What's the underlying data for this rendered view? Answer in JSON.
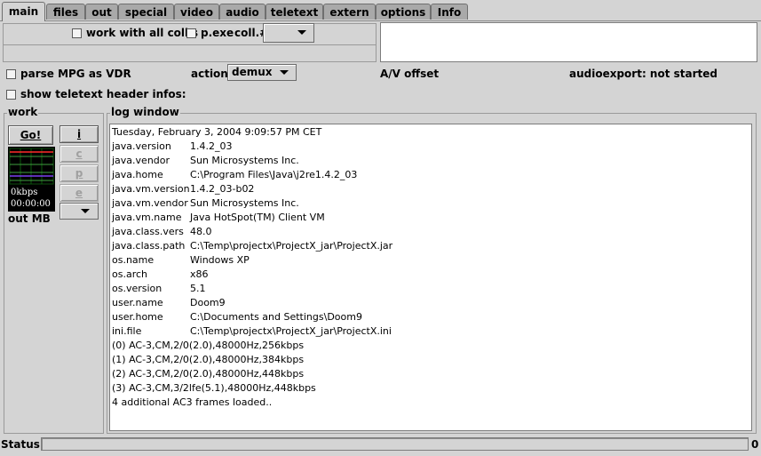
{
  "tabs": [
    {
      "label": "main",
      "active": true
    },
    {
      "label": "files"
    },
    {
      "label": "out"
    },
    {
      "label": "special"
    },
    {
      "label": "video"
    },
    {
      "label": "audio"
    },
    {
      "label": "teletext"
    },
    {
      "label": "extern"
    },
    {
      "label": "options"
    },
    {
      "label": "Info"
    }
  ],
  "options": {
    "work_all_colls": "work with all coll's",
    "pexe": "p.exe",
    "coll_label": "coll.#",
    "coll_value": "",
    "parse_mpg": "parse MPG as VDR",
    "action_label": "action:",
    "action_value": "demux",
    "av_offset": "A/V offset",
    "audioexport": "audioexport: not started",
    "show_teletext": "show teletext header infos:"
  },
  "work": {
    "title": "work",
    "go_button": "Go!",
    "i_button": "i",
    "c_button": "c",
    "p_button": "p",
    "e_button": "e",
    "meter_rate": "0kbps",
    "meter_time": "00:00:00",
    "out_mb": "out MB"
  },
  "log": {
    "title": "log window",
    "date": "Tuesday, February 3, 2004  9:09:57 PM CET",
    "entries": [
      {
        "key": "java.version",
        "value": "1.4.2_03"
      },
      {
        "key": "java.vendor",
        "value": "Sun Microsystems Inc."
      },
      {
        "key": "java.home",
        "value": "C:\\Program Files\\Java\\j2re1.4.2_03"
      },
      {
        "key": "java.vm.version",
        "value": "1.4.2_03-b02"
      },
      {
        "key": "java.vm.vendor",
        "value": "Sun Microsystems Inc."
      },
      {
        "key": "java.vm.name",
        "value": "Java HotSpot(TM) Client VM"
      },
      {
        "key": "java.class.vers",
        "value": "48.0"
      },
      {
        "key": "java.class.path",
        "value": "C:\\Temp\\projectx\\ProjectX_jar\\ProjectX.jar"
      },
      {
        "key": "os.name",
        "value": "Windows XP"
      },
      {
        "key": "os.arch",
        "value": "x86"
      },
      {
        "key": "os.version",
        "value": "5.1"
      },
      {
        "key": "user.name",
        "value": "Doom9"
      },
      {
        "key": "user.home",
        "value": "C:\\Documents and Settings\\Doom9"
      },
      {
        "key": "ini.file",
        "value": "C:\\Temp\\projectx\\ProjectX_jar\\ProjectX.ini"
      }
    ],
    "lines": [
      "(0) AC-3,CM,2/0(2.0),48000Hz,256kbps",
      "(1) AC-3,CM,2/0(2.0),48000Hz,384kbps",
      "(2) AC-3,CM,2/0(2.0),48000Hz,448kbps",
      "(3) AC-3,CM,3/2lfe(5.1),48000Hz,448kbps",
      "4 additional AC3 frames loaded.."
    ]
  },
  "status": {
    "label": "Status:",
    "value": "0",
    "progress": 0
  }
}
